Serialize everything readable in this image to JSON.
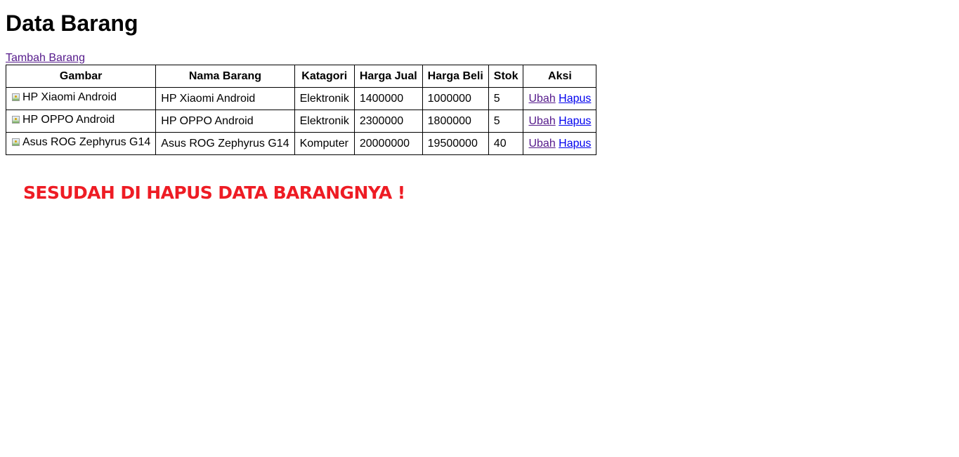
{
  "page": {
    "title": "Data Barang",
    "add_link": "Tambah Barang"
  },
  "table": {
    "headers": [
      "Gambar",
      "Nama Barang",
      "Katagori",
      "Harga Jual",
      "Harga Beli",
      "Stok",
      "Aksi"
    ],
    "rows": [
      {
        "image_alt": "HP Xiaomi Android",
        "name": "HP Xiaomi Android",
        "category": "Elektronik",
        "sell_price": "1400000",
        "buy_price": "1000000",
        "stock": "5",
        "edit_label": "Ubah",
        "delete_label": "Hapus"
      },
      {
        "image_alt": "HP OPPO Android",
        "name": "HP OPPO Android",
        "category": "Elektronik",
        "sell_price": "2300000",
        "buy_price": "1800000",
        "stock": "5",
        "edit_label": "Ubah",
        "delete_label": "Hapus"
      },
      {
        "image_alt": "Asus ROG Zephyrus G14",
        "name": "Asus ROG Zephyrus G14",
        "category": "Komputer",
        "sell_price": "20000000",
        "buy_price": "19500000",
        "stock": "40",
        "edit_label": "Ubah",
        "delete_label": "Hapus"
      }
    ]
  },
  "annotation": {
    "text": "SESUDAH DI HAPUS DATA BARANGNYA !",
    "color": "#ee1c24"
  },
  "colors": {
    "visited_link": "#551a8b",
    "link": "#0000ee"
  },
  "icons": {
    "broken_image": "broken-image-icon"
  }
}
